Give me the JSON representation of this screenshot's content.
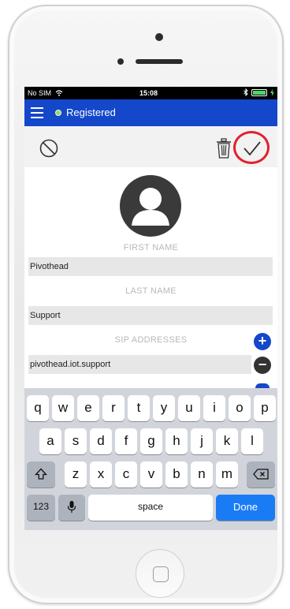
{
  "status_bar": {
    "carrier": "No SIM",
    "time": "15:08",
    "bluetooth": "bluetooth-icon",
    "battery": "battery-icon"
  },
  "app_bar": {
    "title": "Registered",
    "status_color": "#9bd66a",
    "brand_color": "#1447c9"
  },
  "toolbar": {
    "cancel_icon": "cancel-icon",
    "delete_icon": "trash-icon",
    "confirm_icon": "checkmark-icon",
    "highlight_color": "#e3202b"
  },
  "form": {
    "first_name_label": "FIRST NAME",
    "first_name_value": "Pivothead",
    "last_name_label": "LAST NAME",
    "last_name_value": "Support",
    "sip_label": "SIP ADDRESSES",
    "sip_value": "pivothead.iot.support",
    "add_symbol": "+",
    "remove_symbol": "−"
  },
  "keyboard": {
    "row1": [
      "q",
      "w",
      "e",
      "r",
      "t",
      "y",
      "u",
      "i",
      "o",
      "p"
    ],
    "row2": [
      "a",
      "s",
      "d",
      "f",
      "g",
      "h",
      "j",
      "k",
      "l"
    ],
    "row3": [
      "z",
      "x",
      "c",
      "v",
      "b",
      "n",
      "m"
    ],
    "numbers_label": "123",
    "space_label": "space",
    "done_label": "Done"
  }
}
